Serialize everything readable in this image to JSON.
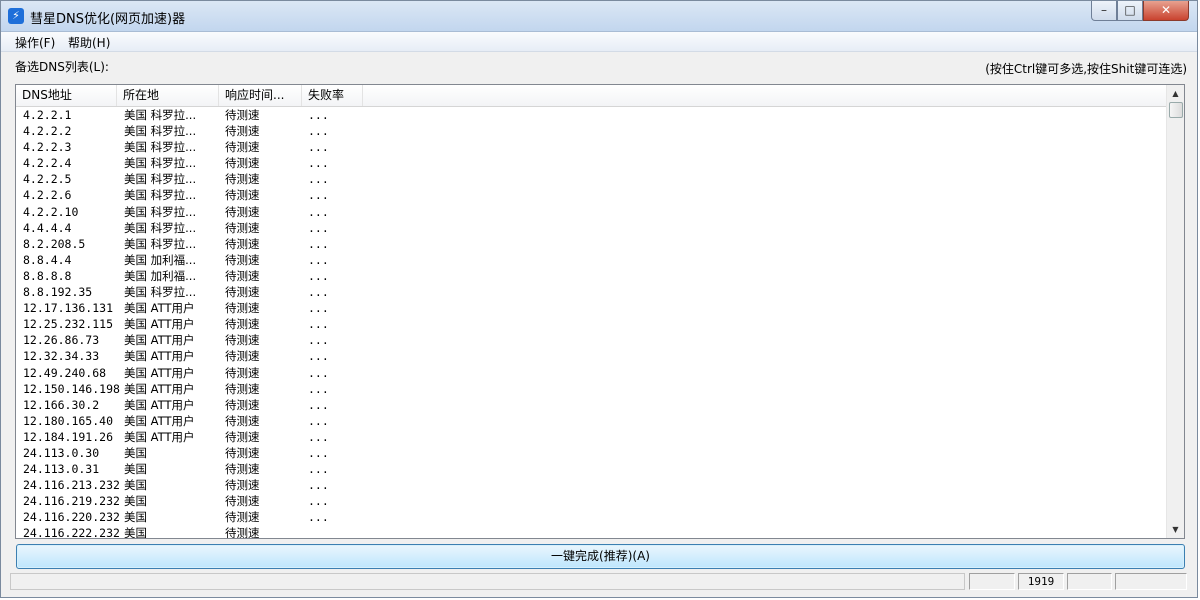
{
  "window": {
    "title": "彗星DNS优化(网页加速)器",
    "controls": {
      "minimize": "–",
      "maximize": "□",
      "close": "✕"
    }
  },
  "menu": [
    {
      "label": "操作(F)"
    },
    {
      "label": "帮助(H)"
    }
  ],
  "list_label": "备选DNS列表(L):",
  "hint": "(按住Ctrl键可多选,按住Shit键可连选)",
  "columns": [
    "DNS地址",
    "所在地",
    "响应时间...",
    "失败率"
  ],
  "rows": [
    [
      "4.2.2.1",
      "美国 科罗拉...",
      "待测速",
      "..."
    ],
    [
      "4.2.2.2",
      "美国 科罗拉...",
      "待测速",
      "..."
    ],
    [
      "4.2.2.3",
      "美国 科罗拉...",
      "待测速",
      "..."
    ],
    [
      "4.2.2.4",
      "美国 科罗拉...",
      "待测速",
      "..."
    ],
    [
      "4.2.2.5",
      "美国 科罗拉...",
      "待测速",
      "..."
    ],
    [
      "4.2.2.6",
      "美国 科罗拉...",
      "待测速",
      "..."
    ],
    [
      "4.2.2.10",
      "美国 科罗拉...",
      "待测速",
      "..."
    ],
    [
      "4.4.4.4",
      "美国 科罗拉...",
      "待测速",
      "..."
    ],
    [
      "8.2.208.5",
      "美国 科罗拉...",
      "待测速",
      "..."
    ],
    [
      "8.8.4.4",
      "美国 加利福...",
      "待测速",
      "..."
    ],
    [
      "8.8.8.8",
      "美国 加利福...",
      "待测速",
      "..."
    ],
    [
      "8.8.192.35",
      "美国 科罗拉...",
      "待测速",
      "..."
    ],
    [
      "12.17.136.131",
      "美国 ATT用户",
      "待测速",
      "..."
    ],
    [
      "12.25.232.115",
      "美国 ATT用户",
      "待测速",
      "..."
    ],
    [
      "12.26.86.73",
      "美国 ATT用户",
      "待测速",
      "..."
    ],
    [
      "12.32.34.33",
      "美国 ATT用户",
      "待测速",
      "..."
    ],
    [
      "12.49.240.68",
      "美国 ATT用户",
      "待测速",
      "..."
    ],
    [
      "12.150.146.198",
      "美国 ATT用户",
      "待测速",
      "..."
    ],
    [
      "12.166.30.2",
      "美国 ATT用户",
      "待测速",
      "..."
    ],
    [
      "12.180.165.40",
      "美国 ATT用户",
      "待测速",
      "..."
    ],
    [
      "12.184.191.26",
      "美国 ATT用户",
      "待测速",
      "..."
    ],
    [
      "24.113.0.30",
      "美国",
      "待测速",
      "..."
    ],
    [
      "24.113.0.31",
      "美国",
      "待测速",
      "..."
    ],
    [
      "24.116.213.232",
      "美国",
      "待测速",
      "..."
    ],
    [
      "24.116.219.232",
      "美国",
      "待测速",
      "..."
    ],
    [
      "24.116.220.232",
      "美国",
      "待测速",
      "..."
    ],
    [
      "24.116.222.232",
      "美国",
      "待测速",
      ""
    ]
  ],
  "action_button": "一键完成(推荐)(A)",
  "status": {
    "count": "1919"
  }
}
